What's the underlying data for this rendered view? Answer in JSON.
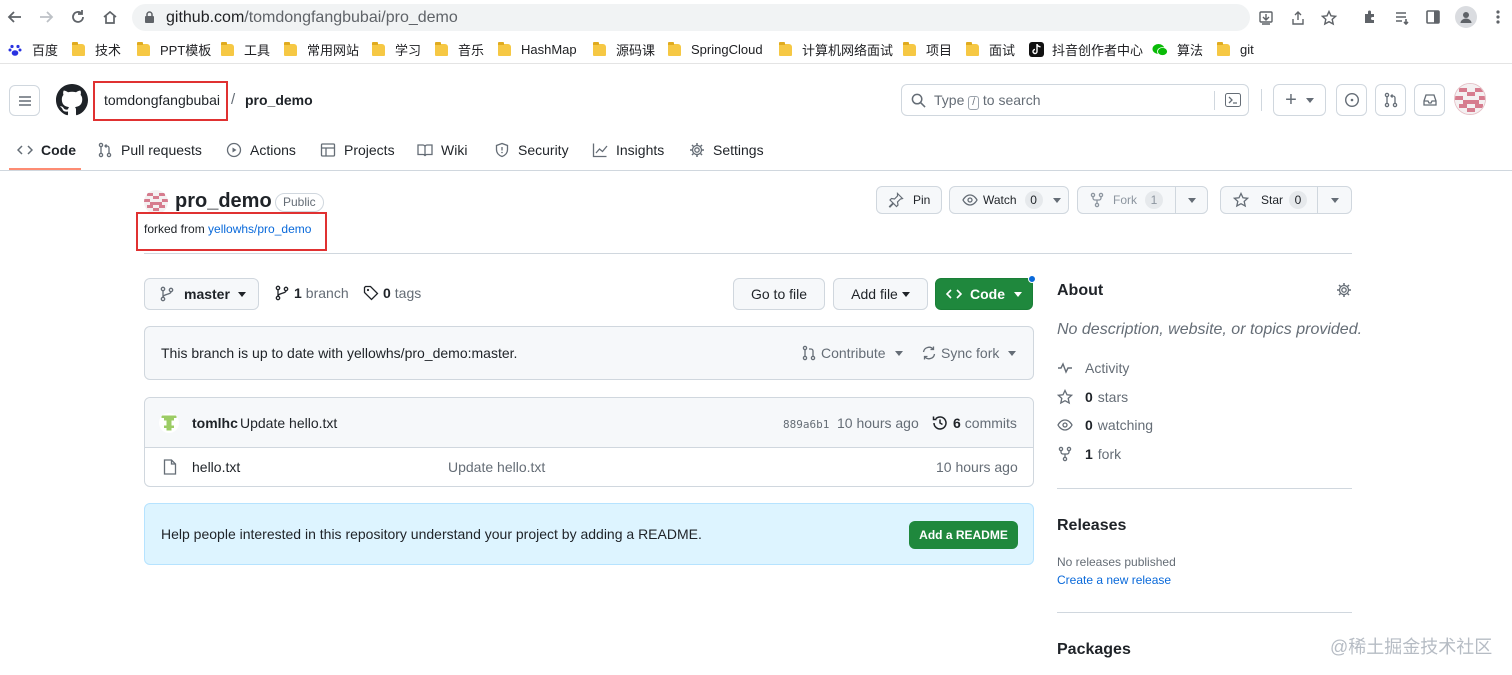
{
  "browser": {
    "url_host": "github.com",
    "url_path": "/tomdongfangbubai/pro_demo",
    "bookmarks": [
      "百度",
      "技术",
      "PPT模板",
      "工具",
      "常用网站",
      "学习",
      "音乐",
      "HashMap",
      "源码课",
      "SpringCloud",
      "计算机网络面试",
      "项目",
      "面试",
      "抖音创作者中心",
      "算法",
      "git"
    ]
  },
  "header": {
    "owner": "tomdongfangbubai",
    "separator": "/",
    "repo": "pro_demo",
    "search_prefix": "Type",
    "search_key": "/",
    "search_suffix": "to search",
    "plus": "+"
  },
  "tabs": [
    "Code",
    "Pull requests",
    "Actions",
    "Projects",
    "Wiki",
    "Security",
    "Insights",
    "Settings"
  ],
  "repo": {
    "name": "pro_demo",
    "visibility": "Public",
    "forked_prefix": "forked from",
    "forked_link": "yellowhs/pro_demo",
    "pin_label": "Pin",
    "watch_label": "Watch",
    "watch_count": "0",
    "fork_label": "Fork",
    "fork_count": "1",
    "star_label": "Star",
    "star_count": "0"
  },
  "toolbar": {
    "branch": "master",
    "branch_count": "1",
    "branch_label": "branch",
    "tags_count": "0",
    "tags_label": "tags",
    "go_to_file": "Go to file",
    "add_file": "Add file",
    "code": "Code"
  },
  "sync": {
    "message": "This branch is up to date with yellowhs/pro_demo:master.",
    "contribute": "Contribute",
    "sync_fork": "Sync fork"
  },
  "commit": {
    "author": "tomlhc",
    "message": "Update hello.txt",
    "sha": "889a6b1",
    "time": "10 hours ago",
    "commits_count": "6",
    "commits_label": "commits"
  },
  "files": [
    {
      "name": "hello.txt",
      "message": "Update hello.txt",
      "time": "10 hours ago"
    }
  ],
  "readme": {
    "text": "Help people interested in this repository understand your project by adding a README.",
    "button": "Add a README"
  },
  "about": {
    "title": "About",
    "description": "No description, website, or topics provided.",
    "activity": "Activity",
    "stars_count": "0",
    "stars_label": "stars",
    "watching_count": "0",
    "watching_label": "watching",
    "fork_count": "1",
    "fork_label": "fork"
  },
  "releases": {
    "title": "Releases",
    "none": "No releases published",
    "create": "Create a new release"
  },
  "packages": {
    "title": "Packages"
  },
  "watermark": "@稀土掘金技术社区",
  "colors": {
    "accent_green": "#1f883d",
    "link_blue": "#0969da",
    "highlight_red": "#e03131",
    "tab_underline": "#fd8c73"
  }
}
